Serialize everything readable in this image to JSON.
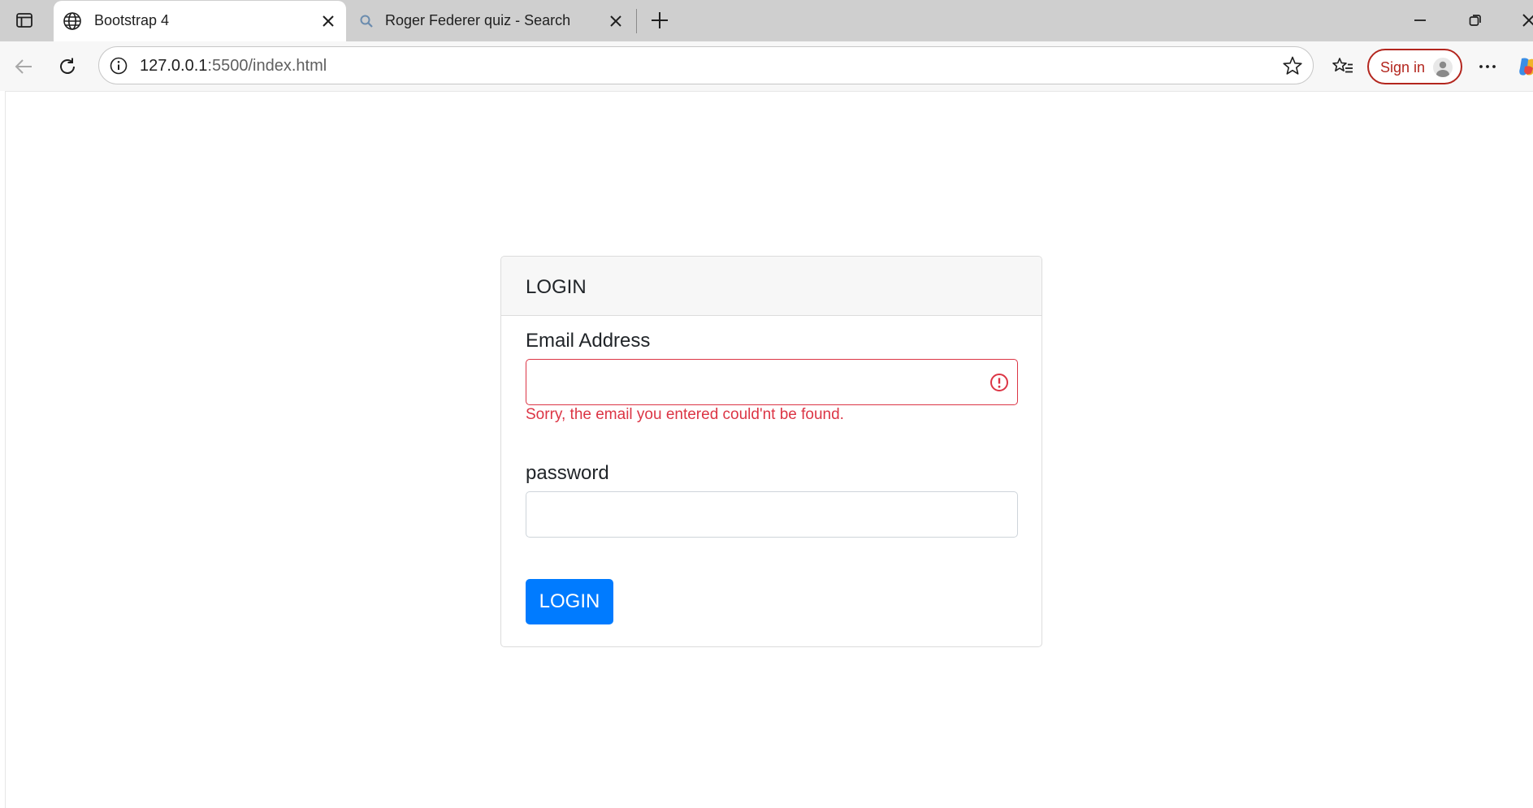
{
  "tabs": [
    {
      "title": "Bootstrap 4",
      "icon": "globe-icon",
      "active": true
    },
    {
      "title": "Roger Federer quiz - Search",
      "icon": "search-icon",
      "active": false
    }
  ],
  "toolbar": {
    "url_host": "127.0.0.1",
    "url_rest": ":5500/index.html",
    "signin_label": "Sign in"
  },
  "colors": {
    "danger": "#dc3545",
    "primary": "#007bff",
    "signin_accent": "#b3261e"
  },
  "login_card": {
    "header": "LOGIN",
    "email_label": "Email Address",
    "email_value": "",
    "email_error": "Sorry, the email you entered could'nt be found.",
    "password_label": "password",
    "password_value": "",
    "submit_label": "LOGIN"
  }
}
